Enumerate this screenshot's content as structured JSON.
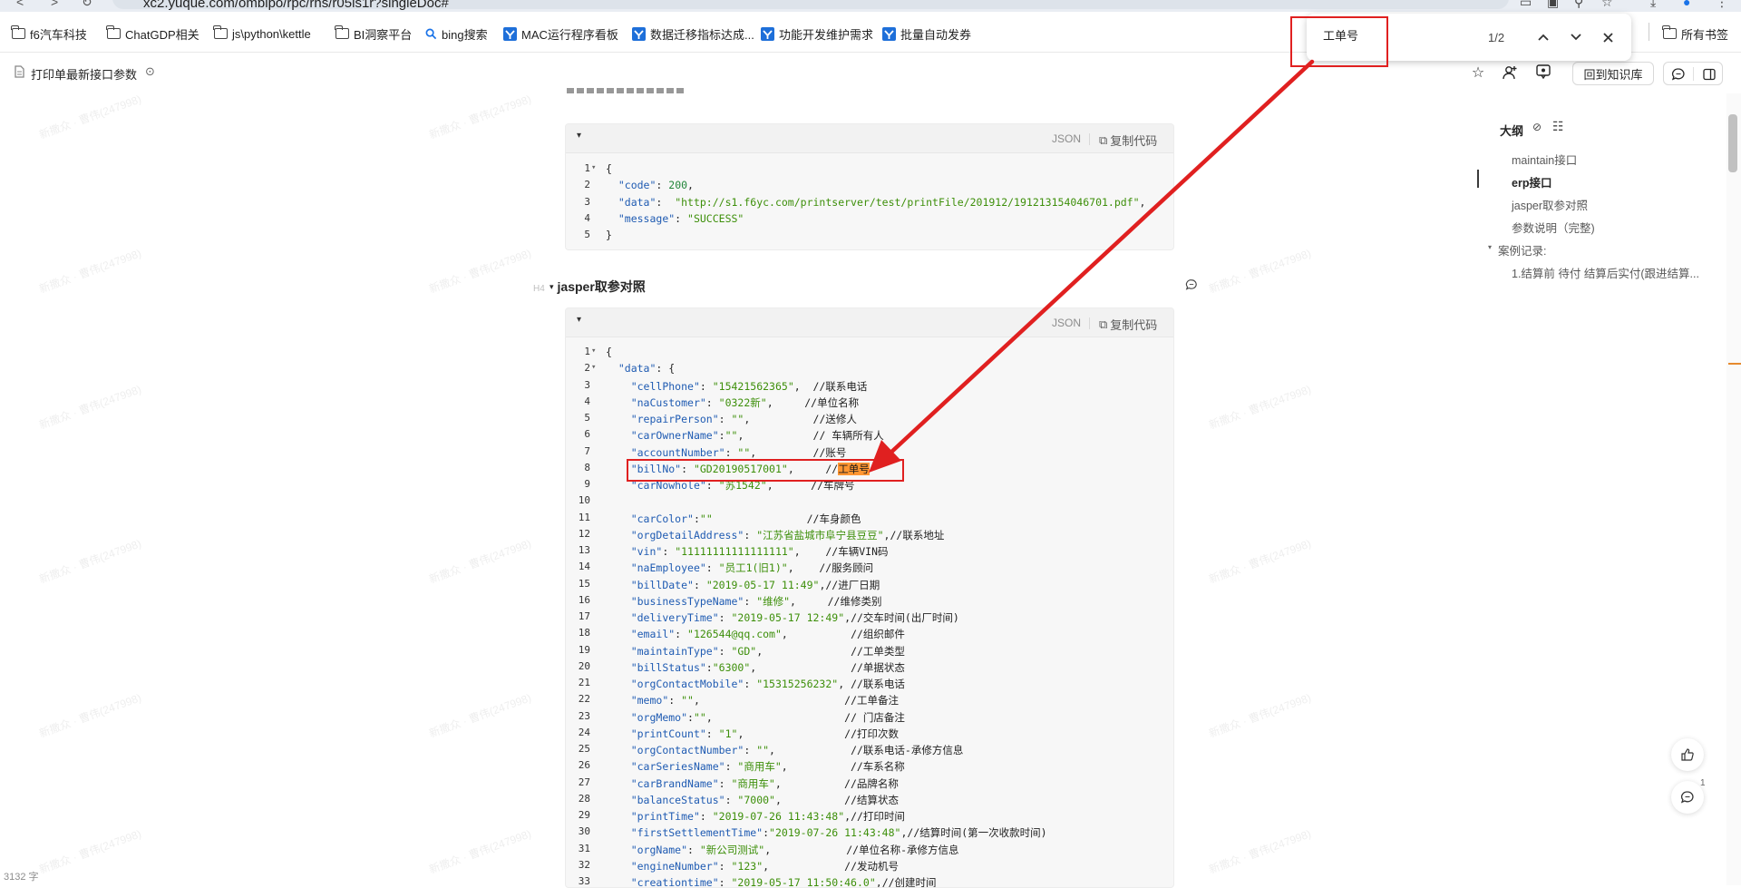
{
  "browser": {
    "url": "xc2.yuque.com/omblpo/rpc/rhs/r05ls1r?singleDoc#",
    "bookmarks": [
      {
        "label": "f6汽车科技",
        "icon": "folder-icon"
      },
      {
        "label": "ChatGDP相关",
        "icon": "folder-icon"
      },
      {
        "label": "js\\python\\kettle",
        "icon": "folder-icon"
      },
      {
        "label": "BI洞察平台",
        "icon": "folder-icon"
      },
      {
        "label": "bing搜索",
        "icon": "search-icon"
      },
      {
        "label": "MAC运行程序看板",
        "icon": "app-icon"
      },
      {
        "label": "数据迁移指标达成...",
        "icon": "app-icon"
      },
      {
        "label": "功能开发维护需求",
        "icon": "app-icon"
      },
      {
        "label": "批量自动发券",
        "icon": "app-icon"
      }
    ],
    "all_bookmarks_label": "所有书签"
  },
  "find_bar": {
    "query": "工单号",
    "count": "1/2"
  },
  "toolbar": {
    "doc_title": "打印单最新接口参数",
    "back_to_kb": "回到知识库"
  },
  "section_heading": {
    "tag": "H4",
    "title": "jasper取参对照"
  },
  "code_blocks": [
    {
      "lang": "JSON",
      "copy_label": "复制代码",
      "lines": [
        {
          "n": "1",
          "fold": true,
          "html": "{"
        },
        {
          "n": "2",
          "html": "  <span class='k'>\"code\"</span>: <span class='n'>200</span>,"
        },
        {
          "n": "3",
          "html": "  <span class='k'>\"data\"</span>:  <span class='s'>\"http://s1.f6yc.com/printserver/test/printFile/201912/191213154046701.pdf\"</span>,"
        },
        {
          "n": "4",
          "html": "  <span class='k'>\"message\"</span>: <span class='s'>\"SUCCESS\"</span>"
        },
        {
          "n": "5",
          "html": "}"
        }
      ]
    },
    {
      "lang": "JSON",
      "copy_label": "复制代码",
      "lines": [
        {
          "n": "1",
          "fold": true,
          "html": "{"
        },
        {
          "n": "2",
          "fold": true,
          "html": "  <span class='k'>\"data\"</span>: {"
        },
        {
          "n": "3",
          "html": "    <span class='k'>\"cellPhone\"</span>: <span class='s'>\"15421562365\"</span>,  <span class='c'>//联系电话</span>"
        },
        {
          "n": "4",
          "html": "    <span class='k'>\"naCustomer\"</span>: <span class='s'>\"0322新\"</span>,     <span class='c'>//单位名称</span>"
        },
        {
          "n": "5",
          "html": "    <span class='k'>\"repairPerson\"</span>: <span class='s'>\"\"</span>,          <span class='c'>//送修人</span>"
        },
        {
          "n": "6",
          "html": "    <span class='k'>\"carOwnerName\"</span>:<span class='s'>\"\"</span>,           <span class='c'>// 车辆所有人</span>"
        },
        {
          "n": "7",
          "html": "    <span class='k'>\"accountNumber\"</span>: <span class='s'>\"\"</span>,         <span class='c'>//账号</span>"
        },
        {
          "n": "8",
          "html": "    <span class='k'>\"billNo\"</span>: <span class='s'>\"GD20190517001\"</span>,     <span class='c'>//<span class='hl'>工单号</span></span>"
        },
        {
          "n": "9",
          "html": "    <span class='k'>\"carNowhole\"</span>: <span class='s'>\"苏1542\"</span>,      <span class='c'>//车牌号</span>"
        },
        {
          "n": "10",
          "html": ""
        },
        {
          "n": "11",
          "html": "    <span class='k'>\"carColor\"</span>:<span class='s'>\"\"</span>               <span class='c'>//车身颜色</span>"
        },
        {
          "n": "12",
          "html": "    <span class='k'>\"orgDetailAddress\"</span>: <span class='s'>\"江苏省盐城市阜宁县豆豆\"</span>,<span class='c'>//联系地址</span>"
        },
        {
          "n": "13",
          "html": "    <span class='k'>\"vin\"</span>: <span class='s'>\"11111111111111111\"</span>,    <span class='c'>//车辆VIN码</span>"
        },
        {
          "n": "14",
          "html": "    <span class='k'>\"naEmployee\"</span>: <span class='s'>\"员工1(旧1)\"</span>,    <span class='c'>//服务顾问</span>"
        },
        {
          "n": "15",
          "html": "    <span class='k'>\"billDate\"</span>: <span class='s'>\"2019-05-17 11:49\"</span>,<span class='c'>//进厂日期</span>"
        },
        {
          "n": "16",
          "html": "    <span class='k'>\"businessTypeName\"</span>: <span class='s'>\"维修\"</span>,     <span class='c'>//维修类别</span>"
        },
        {
          "n": "17",
          "html": "    <span class='k'>\"deliveryTime\"</span>: <span class='s'>\"2019-05-17 12:49\"</span>,<span class='c'>//交车时间(出厂时间)</span>"
        },
        {
          "n": "18",
          "html": "    <span class='k'>\"email\"</span>: <span class='s'>\"126544@qq.com\"</span>,          <span class='c'>//组织邮件</span>"
        },
        {
          "n": "19",
          "html": "    <span class='k'>\"maintainType\"</span>: <span class='s'>\"GD\"</span>,              <span class='c'>//工单类型</span>"
        },
        {
          "n": "20",
          "html": "    <span class='k'>\"billStatus\"</span>:<span class='s'>\"6300\"</span>,               <span class='c'>//单据状态</span>"
        },
        {
          "n": "21",
          "html": "    <span class='k'>\"orgContactMobile\"</span>: <span class='s'>\"15315256232\"</span>, <span class='c'>//联系电话</span>"
        },
        {
          "n": "22",
          "html": "    <span class='k'>\"memo\"</span>: <span class='s'>\"\"</span>,                       <span class='c'>//工单备注</span>"
        },
        {
          "n": "23",
          "html": "    <span class='k'>\"orgMemo\"</span>:<span class='s'>\"\"</span>,                     <span class='c'>// 门店备注</span>"
        },
        {
          "n": "24",
          "html": "    <span class='k'>\"printCount\"</span>: <span class='s'>\"1\"</span>,                <span class='c'>//打印次数</span>"
        },
        {
          "n": "25",
          "html": "    <span class='k'>\"orgContactNumber\"</span>: <span class='s'>\"\"</span>,            <span class='c'>//联系电话-承修方信息</span>"
        },
        {
          "n": "26",
          "html": "    <span class='k'>\"carSeriesName\"</span>: <span class='s'>\"商用车\"</span>,          <span class='c'>//车系名称</span>"
        },
        {
          "n": "27",
          "html": "    <span class='k'>\"carBrandName\"</span>: <span class='s'>\"商用车\"</span>,          <span class='c'>//品牌名称</span>"
        },
        {
          "n": "28",
          "html": "    <span class='k'>\"balanceStatus\"</span>: <span class='s'>\"7000\"</span>,          <span class='c'>//结算状态</span>"
        },
        {
          "n": "29",
          "html": "    <span class='k'>\"printTime\"</span>: <span class='s'>\"2019-07-26 11:43:48\"</span>,<span class='c'>//打印时间</span>"
        },
        {
          "n": "30",
          "html": "    <span class='k'>\"firstSettlementTime\"</span>:<span class='s'>\"2019-07-26 11:43:48\"</span>,<span class='c'>//结算时间(第一次收款时间)</span>"
        },
        {
          "n": "31",
          "html": "    <span class='k'>\"orgName\"</span>: <span class='s'>\"新公司测试\"</span>,            <span class='c'>//单位名称-承修方信息</span>"
        },
        {
          "n": "32",
          "html": "    <span class='k'>\"engineNumber\"</span>: <span class='s'>\"123\"</span>,            <span class='c'>//发动机号</span>"
        },
        {
          "n": "33",
          "html": "    <span class='k'>\"creationtime\"</span>: <span class='s'>\"2019-05-17 11:50:46.0\"</span>,<span class='c'>//创建时间</span>"
        }
      ]
    }
  ],
  "outline": {
    "title": "大纲",
    "items": [
      {
        "label": "maintain接口",
        "active": false
      },
      {
        "label": "erp接口",
        "active": true
      },
      {
        "label": "jasper取参对照",
        "active": false
      },
      {
        "label": "参数说明（完整)",
        "active": false
      },
      {
        "label": "案例记录:",
        "active": false
      },
      {
        "label": "1.结算前 待付 结算后实付(跟进结算...",
        "active": false
      }
    ]
  },
  "word_count": "3132 字",
  "comment_count": "1",
  "watermark": "新撒众 · 曹伟(247998)",
  "colors": {
    "annotation_red": "#e02020",
    "find_highlight": "#ff9632",
    "json_key": "#1f5bb2",
    "json_string": "#3d8f0a"
  }
}
